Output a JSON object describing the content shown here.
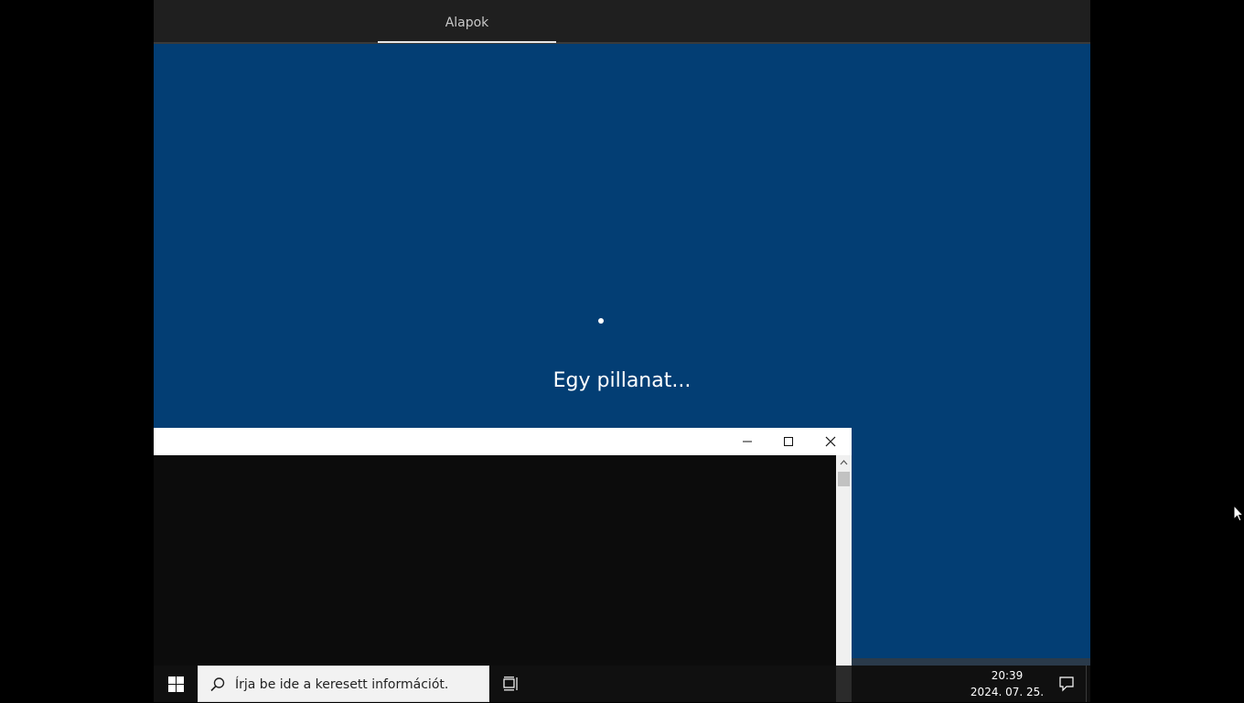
{
  "oobe": {
    "tab_label": "Alapok",
    "status_text": "Egy pillanat..."
  },
  "console_window": {
    "minimize_icon": "minimize-icon",
    "maximize_icon": "maximize-icon",
    "close_icon": "close-icon"
  },
  "taskbar": {
    "start_icon": "windows-logo-icon",
    "search_placeholder": "Írja be ide a keresett információt.",
    "task_view_icon": "task-view-icon",
    "clock_time": "20:39",
    "clock_date": "2024. 07. 25.",
    "notification_icon": "action-center-icon"
  },
  "colors": {
    "oobe_background": "#033e74",
    "header_background": "#1f1f1f",
    "taskbar_background": "#101010",
    "console_background": "#0c0c0c"
  }
}
